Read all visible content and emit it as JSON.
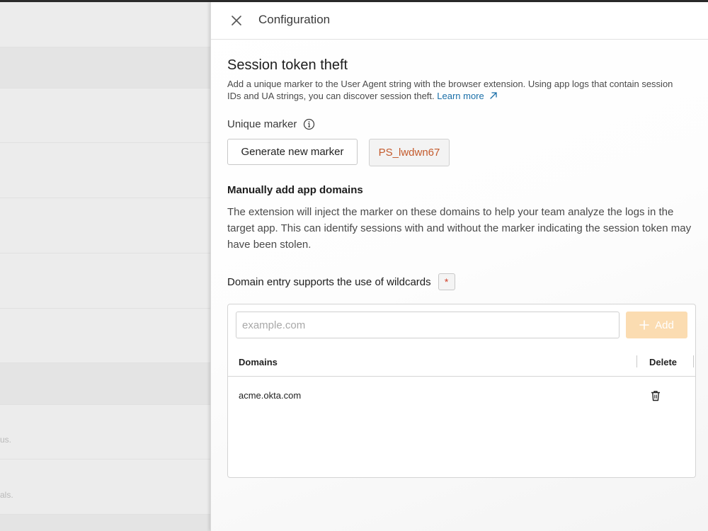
{
  "drawer": {
    "title": "Configuration",
    "close_icon": "close-icon"
  },
  "session": {
    "title": "Session token theft",
    "description": "Add a unique marker to the User Agent string with the browser extension. Using app logs that contain session IDs and UA strings, you can discover session theft.",
    "learn_more": "Learn more",
    "learn_more_icon": "external-link-arrow-icon"
  },
  "unique_marker": {
    "label": "Unique marker",
    "info_icon": "info-icon",
    "generate_label": "Generate new marker",
    "value": "PS_lwdwn67"
  },
  "manual": {
    "title": "Manually add app domains",
    "description": "The extension will inject the marker on these domains to help your team analyze the logs in the target app. This can identify sessions with and without the marker indicating the session token may have been stolen."
  },
  "wildcard": {
    "label": "Domain entry supports the use of wildcards",
    "badge": "*"
  },
  "domain_entry": {
    "placeholder": "example.com",
    "value": "",
    "add_label": "Add",
    "add_icon": "plus-icon"
  },
  "table": {
    "headers": [
      "Domains",
      "Delete"
    ],
    "rows": [
      {
        "domain": "acme.okta.com",
        "delete_icon": "trash-icon"
      }
    ]
  },
  "background": {
    "snippets": [
      "us.",
      "als."
    ]
  },
  "colors": {
    "accent_link": "#1a6fa8",
    "marker_text": "#c45a2c",
    "add_button_disabled": "#fbdcb1",
    "required_asterisk": "#d0402a"
  }
}
